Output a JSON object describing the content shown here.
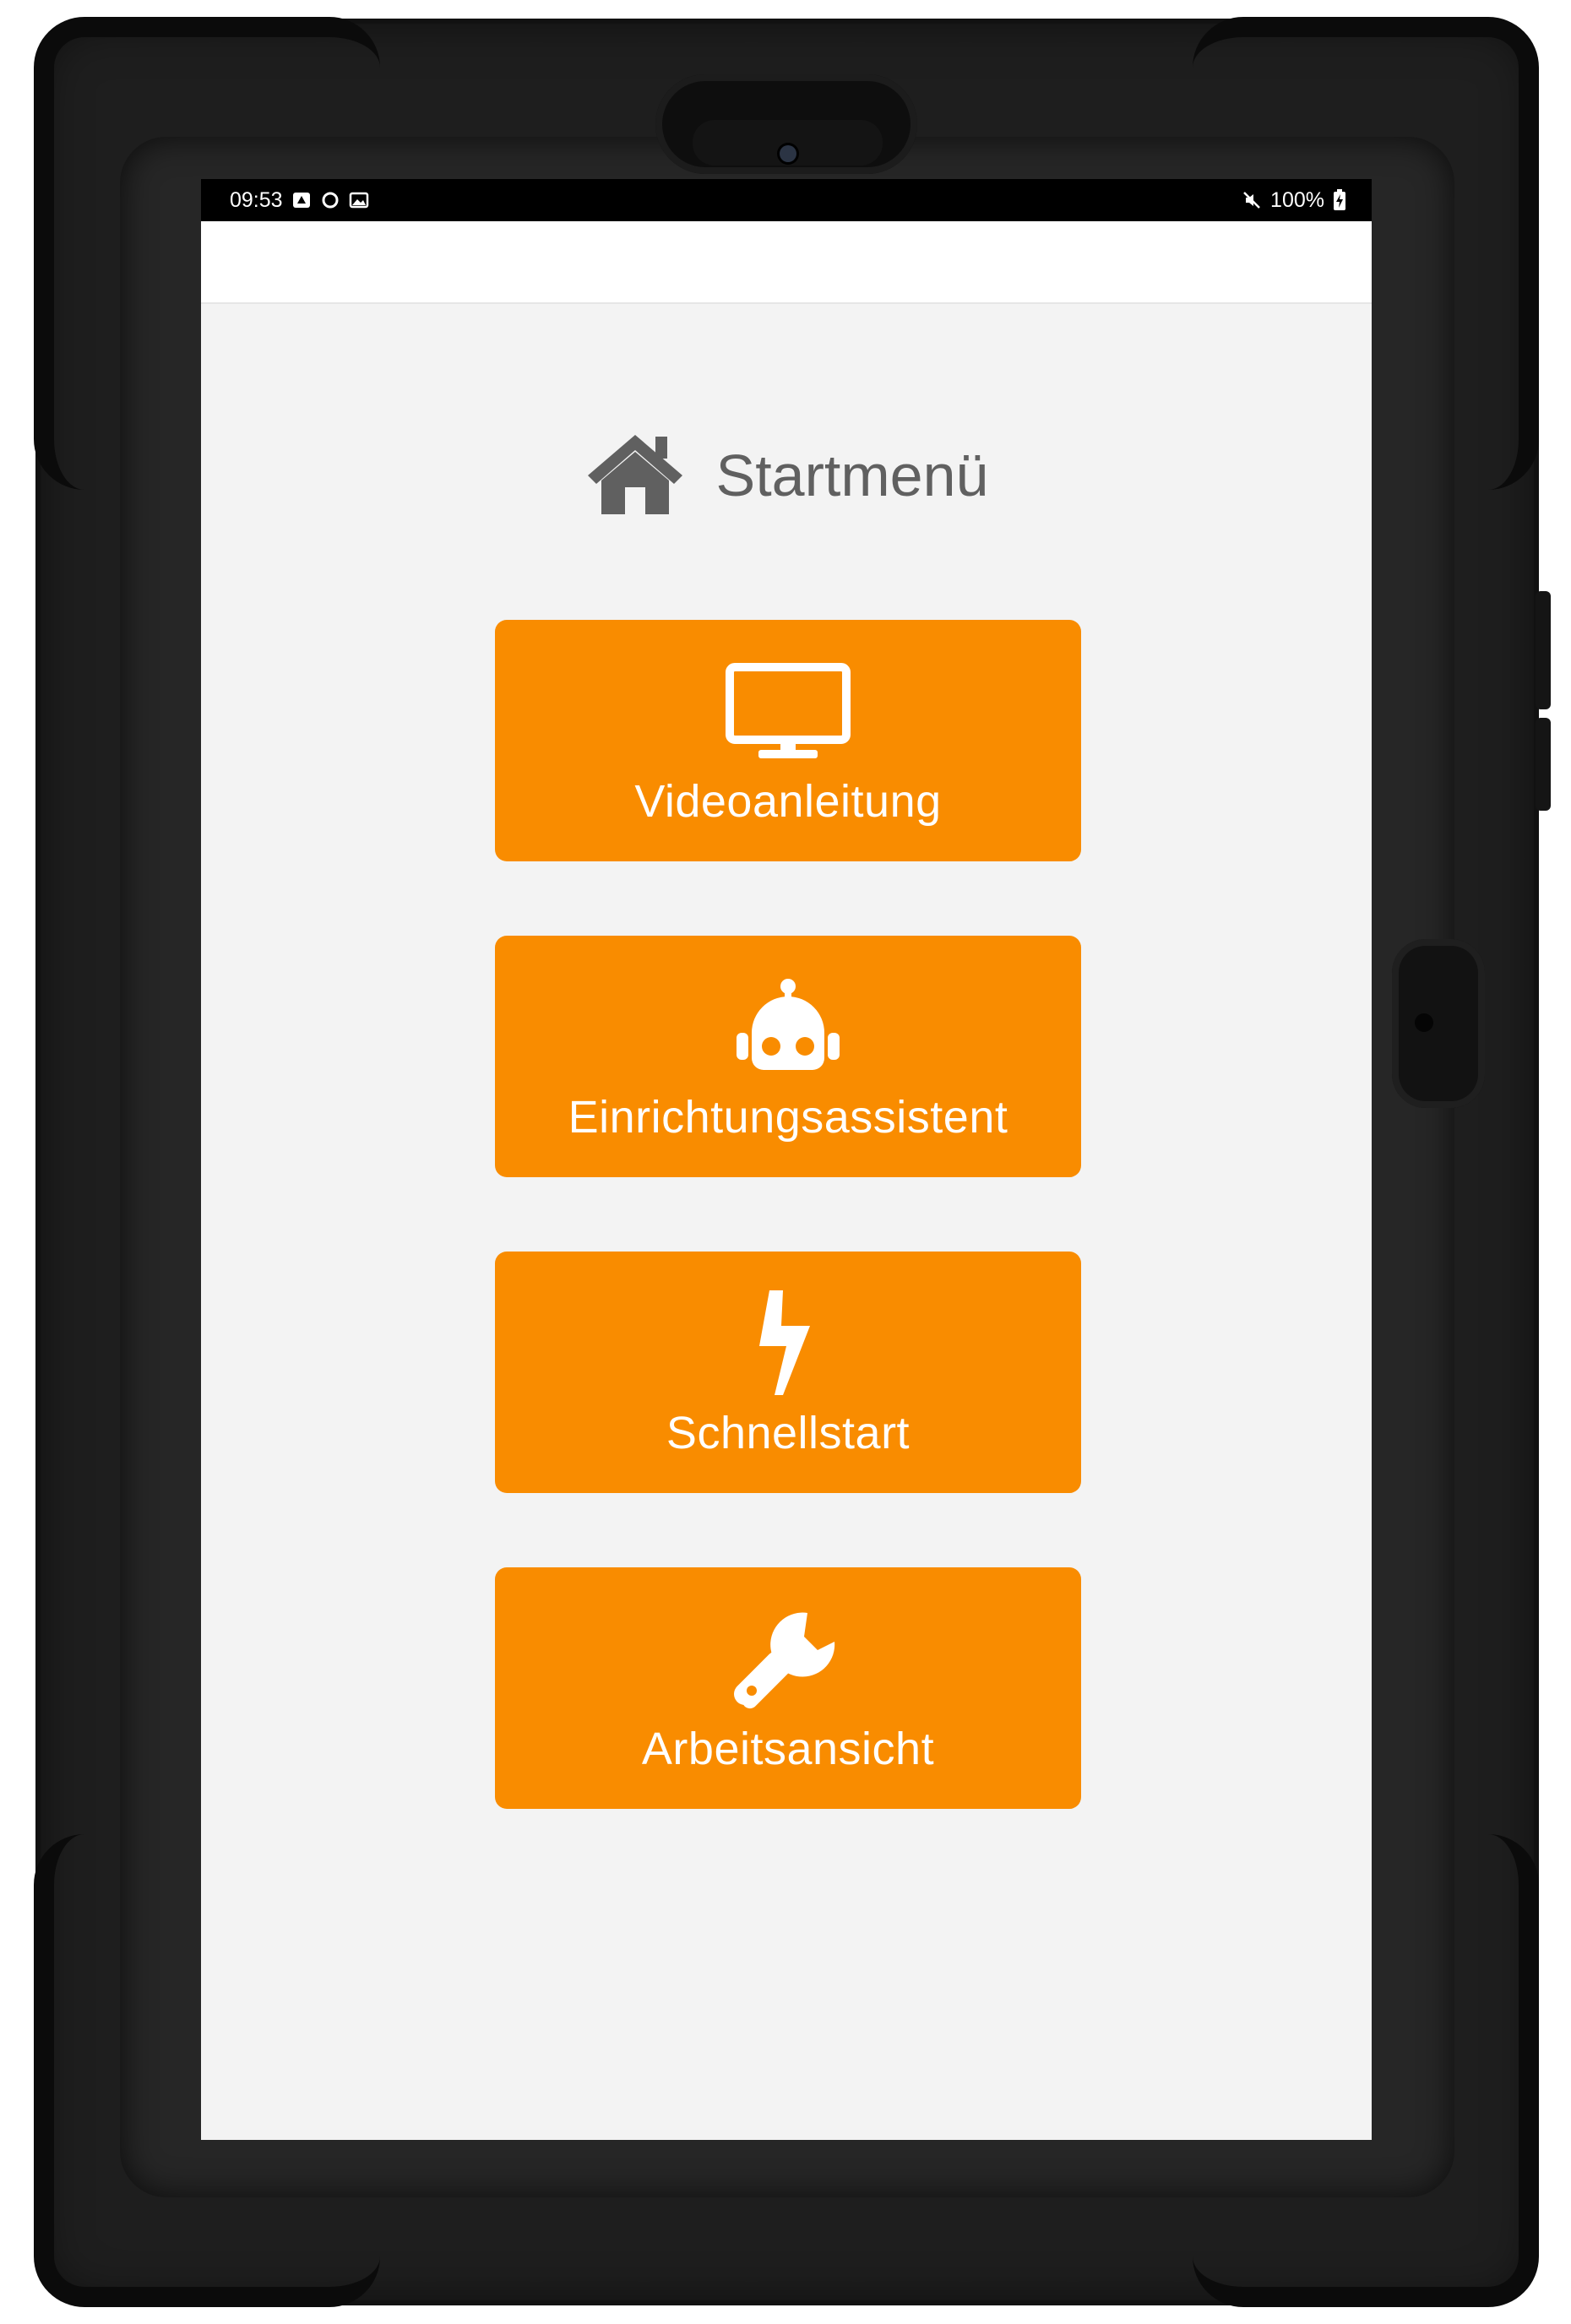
{
  "status_bar": {
    "time": "09:53",
    "battery": "100%",
    "left_icons": [
      "notification-icon",
      "sync-icon",
      "image-icon"
    ],
    "right_icons": [
      "mute-icon",
      "battery-charging-icon"
    ]
  },
  "page": {
    "title": "Startmenü",
    "title_icon": "home-icon"
  },
  "menu": {
    "items": [
      {
        "label": "Videoanleitung",
        "icon": "monitor-icon"
      },
      {
        "label": "Einrichtungsassistent",
        "icon": "robot-icon"
      },
      {
        "label": "Schnellstart",
        "icon": "lightning-icon"
      },
      {
        "label": "Arbeitsansicht",
        "icon": "wrench-icon"
      }
    ]
  },
  "colors": {
    "accent": "#f98c00",
    "background": "#f3f3f3",
    "title_text": "#606060",
    "button_text": "#ffffff",
    "case": "#1e1e1e"
  }
}
